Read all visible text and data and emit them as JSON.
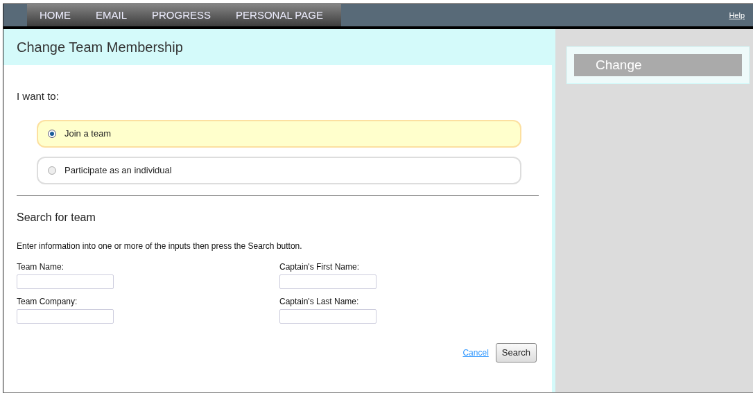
{
  "nav": {
    "items": [
      {
        "label": "HOME"
      },
      {
        "label": "EMAIL"
      },
      {
        "label": "PROGRESS"
      },
      {
        "label": "PERSONAL PAGE"
      }
    ],
    "help": "Help"
  },
  "page": {
    "title": "Change Team Membership",
    "prompt": "I want to:",
    "options": [
      {
        "label": "Join a team",
        "selected": true
      },
      {
        "label": "Participate as an individual",
        "selected": false
      }
    ],
    "search": {
      "heading": "Search for team",
      "instructions": "Enter information into one or more of the inputs then press the Search button.",
      "fields": [
        {
          "label": "Team Name:"
        },
        {
          "label": "Captain's First Name:"
        },
        {
          "label": "Team Company:"
        },
        {
          "label": "Captain's Last Name:"
        }
      ],
      "cancel": "Cancel",
      "submit": "Search"
    }
  },
  "sidebar": {
    "button": "Change"
  }
}
